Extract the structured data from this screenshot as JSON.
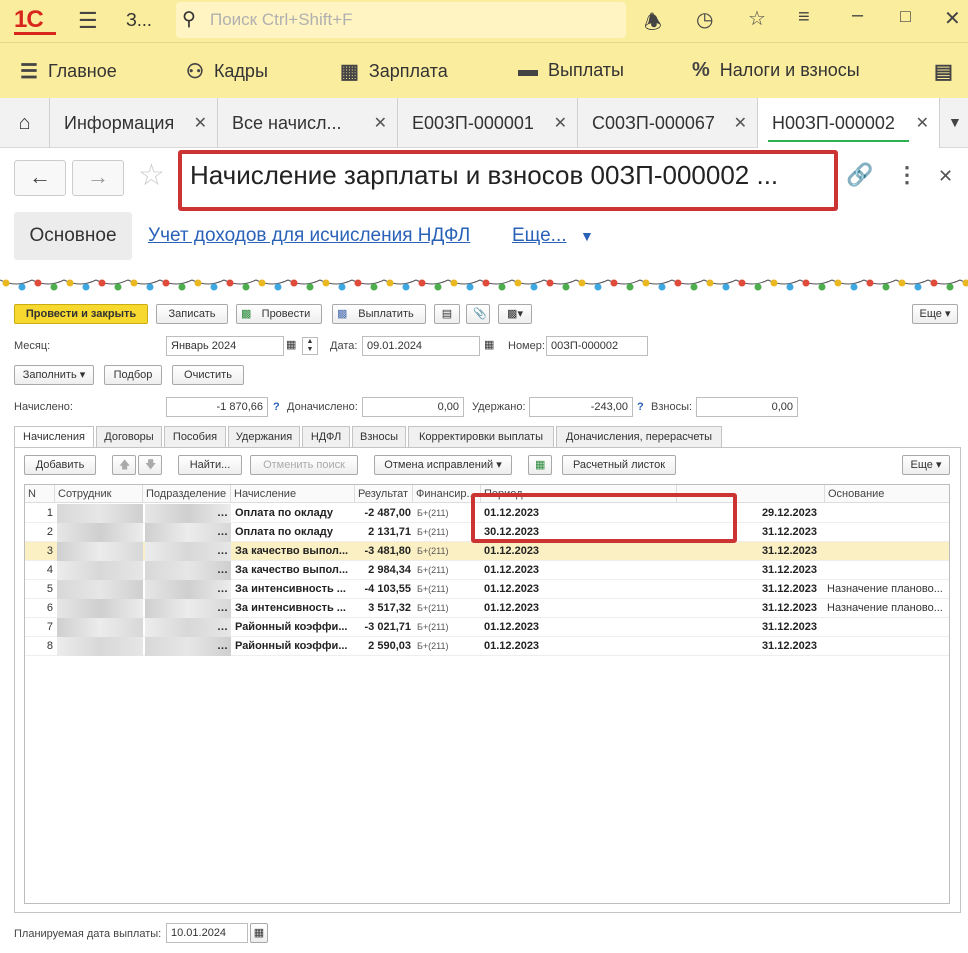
{
  "topbar": {
    "app_short": "З...",
    "search_placeholder": "Поиск Ctrl+Shift+F"
  },
  "sections": [
    {
      "label": "Главное",
      "icon": "menu-icon"
    },
    {
      "label": "Кадры",
      "icon": "people-icon"
    },
    {
      "label": "Зарплата",
      "icon": "calculator-icon"
    },
    {
      "label": "Выплаты",
      "icon": "card-icon"
    },
    {
      "label": "Налоги и взносы",
      "icon": "percent-icon"
    }
  ],
  "open_tabs": [
    {
      "label": "Информация"
    },
    {
      "label": "Все начисл..."
    },
    {
      "label": "Е00ЗП-000001"
    },
    {
      "label": "С00ЗП-000067"
    },
    {
      "label": "Н00ЗП-000002"
    }
  ],
  "document": {
    "title": "Начисление зарплаты и взносов 00ЗП-000002 ..."
  },
  "form_tabs": {
    "main": "Основное",
    "ndfl_link": "Учет доходов для исчисления НДФЛ",
    "more": "Еще..."
  },
  "toolbar": {
    "post_close": "Провести и закрыть",
    "save": "Записать",
    "post": "Провести",
    "pay": "Выплатить",
    "more": "Еще"
  },
  "fields": {
    "month_label": "Месяц:",
    "month_value": "Январь 2024",
    "date_label": "Дата:",
    "date_value": "09.01.2024",
    "number_label": "Номер:",
    "number_value": "00ЗП-000002",
    "fill": "Заполнить",
    "select": "Подбор",
    "clear": "Очистить",
    "accrued_label": "Начислено:",
    "accrued_value": "-1 870,66",
    "additional_label": "Доначислено:",
    "additional_value": "0,00",
    "withheld_label": "Удержано:",
    "withheld_value": "-243,00",
    "contrib_label": "Взносы:",
    "contrib_value": "0,00",
    "qmark": "?"
  },
  "sub_tabs": [
    "Начисления",
    "Договоры",
    "Пособия",
    "Удержания",
    "НДФЛ",
    "Взносы",
    "Корректировки выплаты",
    "Доначисления, перерасчеты"
  ],
  "table_toolbar": {
    "add": "Добавить",
    "find": "Найти...",
    "cancel_search": "Отменить поиск",
    "cancel_corrections": "Отмена исправлений",
    "payslip": "Расчетный листок",
    "more": "Еще"
  },
  "table": {
    "columns": [
      "N",
      "Сотрудник",
      "Подразделение",
      "Начисление",
      "Результат",
      "Финансир...",
      "Период",
      "",
      "Основание"
    ],
    "rows": [
      {
        "n": "1",
        "accrual": "Оплата по окладу",
        "result": "-2 487,00",
        "fin": "Б+(211)",
        "from": "01.12.2023",
        "to": "29.12.2023",
        "basis": ""
      },
      {
        "n": "2",
        "accrual": "Оплата по окладу",
        "result": "2 131,71",
        "fin": "Б+(211)",
        "from": "30.12.2023",
        "to": "31.12.2023",
        "basis": ""
      },
      {
        "n": "3",
        "accrual": "За качество выпол...",
        "result": "-3 481,80",
        "fin": "Б+(211)",
        "from": "01.12.2023",
        "to": "31.12.2023",
        "basis": ""
      },
      {
        "n": "4",
        "accrual": "За качество выпол...",
        "result": "2 984,34",
        "fin": "Б+(211)",
        "from": "01.12.2023",
        "to": "31.12.2023",
        "basis": ""
      },
      {
        "n": "5",
        "accrual": "За интенсивность ...",
        "result": "-4 103,55",
        "fin": "Б+(211)",
        "from": "01.12.2023",
        "to": "31.12.2023",
        "basis": "Назначение планово..."
      },
      {
        "n": "6",
        "accrual": "За интенсивность ...",
        "result": "3 517,32",
        "fin": "Б+(211)",
        "from": "01.12.2023",
        "to": "31.12.2023",
        "basis": "Назначение планово..."
      },
      {
        "n": "7",
        "accrual": "Районный коэффи...",
        "result": "-3 021,71",
        "fin": "Б+(211)",
        "from": "01.12.2023",
        "to": "31.12.2023",
        "basis": ""
      },
      {
        "n": "8",
        "accrual": "Районный коэффи...",
        "result": "2 590,03",
        "fin": "Б+(211)",
        "from": "01.12.2023",
        "to": "31.12.2023",
        "basis": ""
      }
    ]
  },
  "footer": {
    "pay_date_label": "Планируемая дата выплаты:",
    "pay_date_value": "10.01.2024"
  },
  "colors": {
    "topbar": "#fbed9e",
    "accent_red": "#cc3333",
    "link": "#2a62b8",
    "selected_row": "#fbf0c4"
  }
}
